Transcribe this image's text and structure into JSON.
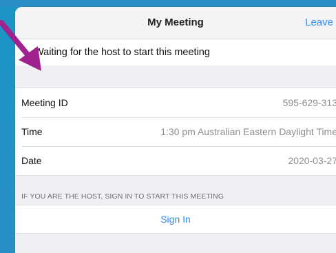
{
  "nav": {
    "title": "My Meeting",
    "leave_label": "Leave"
  },
  "status": {
    "waiting_text": "Waiting for the host to start this meeting"
  },
  "details": [
    {
      "label": "Meeting ID",
      "value": "595-629-313"
    },
    {
      "label": "Time",
      "value": "1:30 pm Australian Eastern Daylight Time"
    },
    {
      "label": "Date",
      "value": "2020-03-27"
    }
  ],
  "host_section": {
    "header": "IF YOU ARE THE HOST, SIGN IN TO START THIS MEETING",
    "signin_label": "Sign In"
  },
  "colors": {
    "accent": "#2d8cff",
    "annotation_arrow": "#a0228f",
    "background": "#1b95c6"
  },
  "icons": {
    "annotation": "arrow-pointer-icon"
  }
}
